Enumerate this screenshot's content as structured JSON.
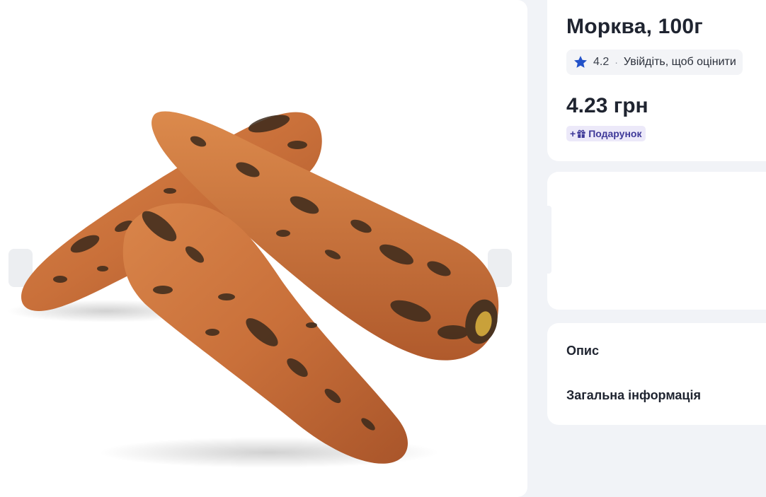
{
  "product": {
    "title": "Морква, 100г",
    "rating": "4.2",
    "rating_separator": "·",
    "rating_login": "Увійдіть, щоб оцінити",
    "price": "4.23 грн",
    "gift_label": "Подарунок",
    "gift_prefix": "+"
  },
  "gallery": {
    "image": "carrots-photo",
    "prev_icon": "chevron-left-icon",
    "next_icon": "chevron-right-icon"
  },
  "info": {
    "description_label": "Опис",
    "general_info_label": "Загальна інформація"
  },
  "colors": {
    "star": "#2352c9",
    "gift_text": "#3f3a99",
    "gift_bg": "#ece9f9",
    "page_bg": "#f1f3f7"
  }
}
